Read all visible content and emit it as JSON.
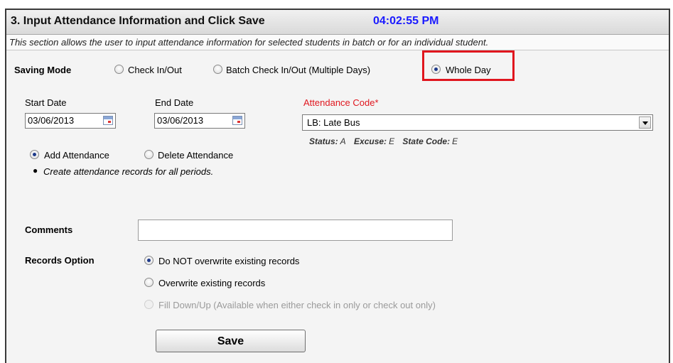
{
  "header": {
    "title": "3. Input Attendance Information and Click Save",
    "time": "04:02:55 PM"
  },
  "description": "This section allows the user to input attendance information for selected students in batch or for an individual student.",
  "saving_mode": {
    "label": "Saving Mode",
    "options": [
      {
        "label": "Check In/Out",
        "checked": false
      },
      {
        "label": "Batch Check In/Out (Multiple Days)",
        "checked": false
      },
      {
        "label": "Whole Day",
        "checked": true
      }
    ],
    "highlight_color": "#e0161e"
  },
  "dates": {
    "start_label": "Start Date",
    "start_value": "03/06/2013",
    "end_label": "End Date",
    "end_value": "03/06/2013"
  },
  "attendance_code": {
    "label": "Attendance Code*",
    "label_color": "#e0161e",
    "selected": "LB: Late Bus",
    "status_label": "Status:",
    "status_value": "A",
    "excuse_label": "Excuse:",
    "excuse_value": "E",
    "state_code_label": "State Code:",
    "state_code_value": "E"
  },
  "action": {
    "options": [
      {
        "label": "Add Attendance",
        "checked": true
      },
      {
        "label": "Delete Attendance",
        "checked": false
      }
    ],
    "note": "Create attendance records for all periods."
  },
  "comments": {
    "label": "Comments",
    "value": ""
  },
  "records_option": {
    "label": "Records Option",
    "options": [
      {
        "label": "Do NOT overwrite existing records",
        "checked": true,
        "disabled": false
      },
      {
        "label": "Overwrite existing records",
        "checked": false,
        "disabled": false
      },
      {
        "label": "Fill Down/Up (Available when either check in only or check out only)",
        "checked": false,
        "disabled": true
      }
    ]
  },
  "save_label": "Save"
}
